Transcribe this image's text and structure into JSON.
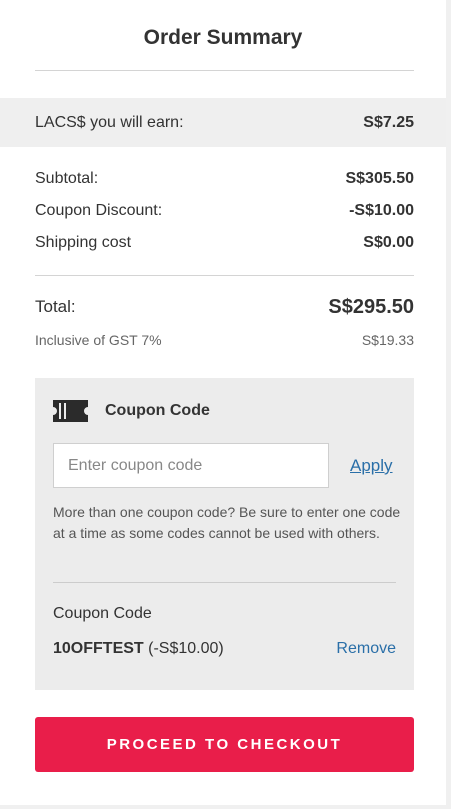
{
  "order_summary": {
    "title": "Order Summary",
    "earn": {
      "label": "LACS$ you will earn:",
      "value": "S$7.25"
    },
    "subtotal": {
      "label": "Subtotal:",
      "value": "S$305.50"
    },
    "coupon_discount": {
      "label": "Coupon Discount:",
      "value": "-S$10.00"
    },
    "shipping": {
      "label": "Shipping cost",
      "value": "S$0.00"
    },
    "total": {
      "label": "Total:",
      "value": "S$295.50"
    },
    "gst": {
      "label": "Inclusive of GST 7%",
      "value": "S$19.33"
    }
  },
  "coupon": {
    "icon": "ticket-icon",
    "title": "Coupon Code",
    "input_placeholder": "Enter coupon code",
    "input_value": "",
    "apply_label": "Apply",
    "help_text": "More than one coupon code? Be sure to enter one code at a time as some codes cannot be used with others.",
    "applied_title": "Coupon Code",
    "applied_code": "10OFFTEST",
    "applied_amount": "(-S$10.00)",
    "remove_label": "Remove"
  },
  "checkout": {
    "label": "PROCEED TO CHECKOUT"
  },
  "colors": {
    "checkout_bg": "#e91e4a",
    "link": "#2a6fa8",
    "panel_bg": "#ececec"
  }
}
